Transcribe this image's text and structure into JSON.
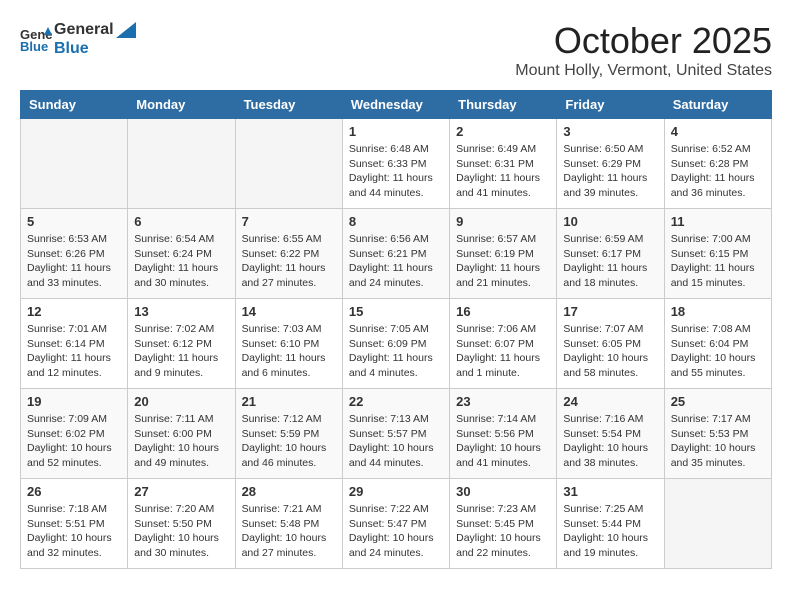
{
  "header": {
    "logo_general": "General",
    "logo_blue": "Blue",
    "month": "October 2025",
    "location": "Mount Holly, Vermont, United States"
  },
  "weekdays": [
    "Sunday",
    "Monday",
    "Tuesday",
    "Wednesday",
    "Thursday",
    "Friday",
    "Saturday"
  ],
  "weeks": [
    [
      {
        "day": "",
        "empty": true
      },
      {
        "day": "",
        "empty": true
      },
      {
        "day": "",
        "empty": true
      },
      {
        "day": "1",
        "sunrise": "6:48 AM",
        "sunset": "6:33 PM",
        "daylight": "11 hours and 44 minutes."
      },
      {
        "day": "2",
        "sunrise": "6:49 AM",
        "sunset": "6:31 PM",
        "daylight": "11 hours and 41 minutes."
      },
      {
        "day": "3",
        "sunrise": "6:50 AM",
        "sunset": "6:29 PM",
        "daylight": "11 hours and 39 minutes."
      },
      {
        "day": "4",
        "sunrise": "6:52 AM",
        "sunset": "6:28 PM",
        "daylight": "11 hours and 36 minutes."
      }
    ],
    [
      {
        "day": "5",
        "sunrise": "6:53 AM",
        "sunset": "6:26 PM",
        "daylight": "11 hours and 33 minutes."
      },
      {
        "day": "6",
        "sunrise": "6:54 AM",
        "sunset": "6:24 PM",
        "daylight": "11 hours and 30 minutes."
      },
      {
        "day": "7",
        "sunrise": "6:55 AM",
        "sunset": "6:22 PM",
        "daylight": "11 hours and 27 minutes."
      },
      {
        "day": "8",
        "sunrise": "6:56 AM",
        "sunset": "6:21 PM",
        "daylight": "11 hours and 24 minutes."
      },
      {
        "day": "9",
        "sunrise": "6:57 AM",
        "sunset": "6:19 PM",
        "daylight": "11 hours and 21 minutes."
      },
      {
        "day": "10",
        "sunrise": "6:59 AM",
        "sunset": "6:17 PM",
        "daylight": "11 hours and 18 minutes."
      },
      {
        "day": "11",
        "sunrise": "7:00 AM",
        "sunset": "6:15 PM",
        "daylight": "11 hours and 15 minutes."
      }
    ],
    [
      {
        "day": "12",
        "sunrise": "7:01 AM",
        "sunset": "6:14 PM",
        "daylight": "11 hours and 12 minutes."
      },
      {
        "day": "13",
        "sunrise": "7:02 AM",
        "sunset": "6:12 PM",
        "daylight": "11 hours and 9 minutes."
      },
      {
        "day": "14",
        "sunrise": "7:03 AM",
        "sunset": "6:10 PM",
        "daylight": "11 hours and 6 minutes."
      },
      {
        "day": "15",
        "sunrise": "7:05 AM",
        "sunset": "6:09 PM",
        "daylight": "11 hours and 4 minutes."
      },
      {
        "day": "16",
        "sunrise": "7:06 AM",
        "sunset": "6:07 PM",
        "daylight": "11 hours and 1 minute."
      },
      {
        "day": "17",
        "sunrise": "7:07 AM",
        "sunset": "6:05 PM",
        "daylight": "10 hours and 58 minutes."
      },
      {
        "day": "18",
        "sunrise": "7:08 AM",
        "sunset": "6:04 PM",
        "daylight": "10 hours and 55 minutes."
      }
    ],
    [
      {
        "day": "19",
        "sunrise": "7:09 AM",
        "sunset": "6:02 PM",
        "daylight": "10 hours and 52 minutes."
      },
      {
        "day": "20",
        "sunrise": "7:11 AM",
        "sunset": "6:00 PM",
        "daylight": "10 hours and 49 minutes."
      },
      {
        "day": "21",
        "sunrise": "7:12 AM",
        "sunset": "5:59 PM",
        "daylight": "10 hours and 46 minutes."
      },
      {
        "day": "22",
        "sunrise": "7:13 AM",
        "sunset": "5:57 PM",
        "daylight": "10 hours and 44 minutes."
      },
      {
        "day": "23",
        "sunrise": "7:14 AM",
        "sunset": "5:56 PM",
        "daylight": "10 hours and 41 minutes."
      },
      {
        "day": "24",
        "sunrise": "7:16 AM",
        "sunset": "5:54 PM",
        "daylight": "10 hours and 38 minutes."
      },
      {
        "day": "25",
        "sunrise": "7:17 AM",
        "sunset": "5:53 PM",
        "daylight": "10 hours and 35 minutes."
      }
    ],
    [
      {
        "day": "26",
        "sunrise": "7:18 AM",
        "sunset": "5:51 PM",
        "daylight": "10 hours and 32 minutes."
      },
      {
        "day": "27",
        "sunrise": "7:20 AM",
        "sunset": "5:50 PM",
        "daylight": "10 hours and 30 minutes."
      },
      {
        "day": "28",
        "sunrise": "7:21 AM",
        "sunset": "5:48 PM",
        "daylight": "10 hours and 27 minutes."
      },
      {
        "day": "29",
        "sunrise": "7:22 AM",
        "sunset": "5:47 PM",
        "daylight": "10 hours and 24 minutes."
      },
      {
        "day": "30",
        "sunrise": "7:23 AM",
        "sunset": "5:45 PM",
        "daylight": "10 hours and 22 minutes."
      },
      {
        "day": "31",
        "sunrise": "7:25 AM",
        "sunset": "5:44 PM",
        "daylight": "10 hours and 19 minutes."
      },
      {
        "day": "",
        "empty": true
      }
    ]
  ],
  "labels": {
    "sunrise": "Sunrise:",
    "sunset": "Sunset:",
    "daylight": "Daylight:"
  }
}
